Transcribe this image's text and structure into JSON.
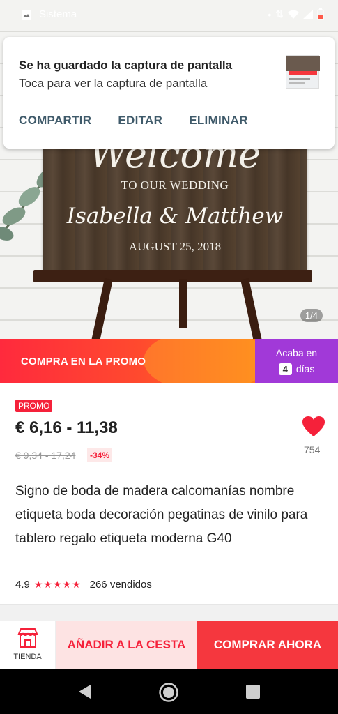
{
  "statusbar": {
    "title": "Sistema",
    "battery_icon": "battery-icon",
    "wifi_icon": "wifi-icon",
    "signal_icon": "signal-icon"
  },
  "notification": {
    "title": "Se ha guardado la captura de pantalla",
    "subtitle": "Toca para ver la captura de pantalla",
    "actions": [
      "COMPARTIR",
      "EDITAR",
      "ELIMINAR"
    ]
  },
  "hero": {
    "sign_welcome": "Welcome",
    "sign_line1": "TO OUR WEDDING",
    "sign_names": "Isabella & Matthew",
    "sign_date": "AUGUST 25, 2018",
    "counter": "1/4"
  },
  "promo": {
    "label": "COMPRA EN LA PROMO",
    "ends_label": "Acaba en",
    "days_number": "4",
    "days_label": "días"
  },
  "product": {
    "badge": "PROMO",
    "price": "€ 6,16 - 11,38",
    "old_price": "€ 9,34 - 17,24",
    "discount": "-34%",
    "wishlist_count": "754",
    "title": "Signo de boda de madera calcomanías nombre etiqueta boda decoración pegatinas de vinilo para tablero regalo etiqueta moderna G40",
    "rating": "4.9",
    "stars": "★★★★★",
    "sold": "266 vendidos"
  },
  "actions": {
    "store_label": "TIENDA",
    "add_to_cart": "AÑADIR A LA CESTA",
    "buy_now": "COMPRAR AHORA"
  },
  "colors": {
    "accent": "#f5213a",
    "promo_purple": "#a139d8",
    "cart_bg": "#fde3e3",
    "buy_bg": "#f5373e"
  }
}
